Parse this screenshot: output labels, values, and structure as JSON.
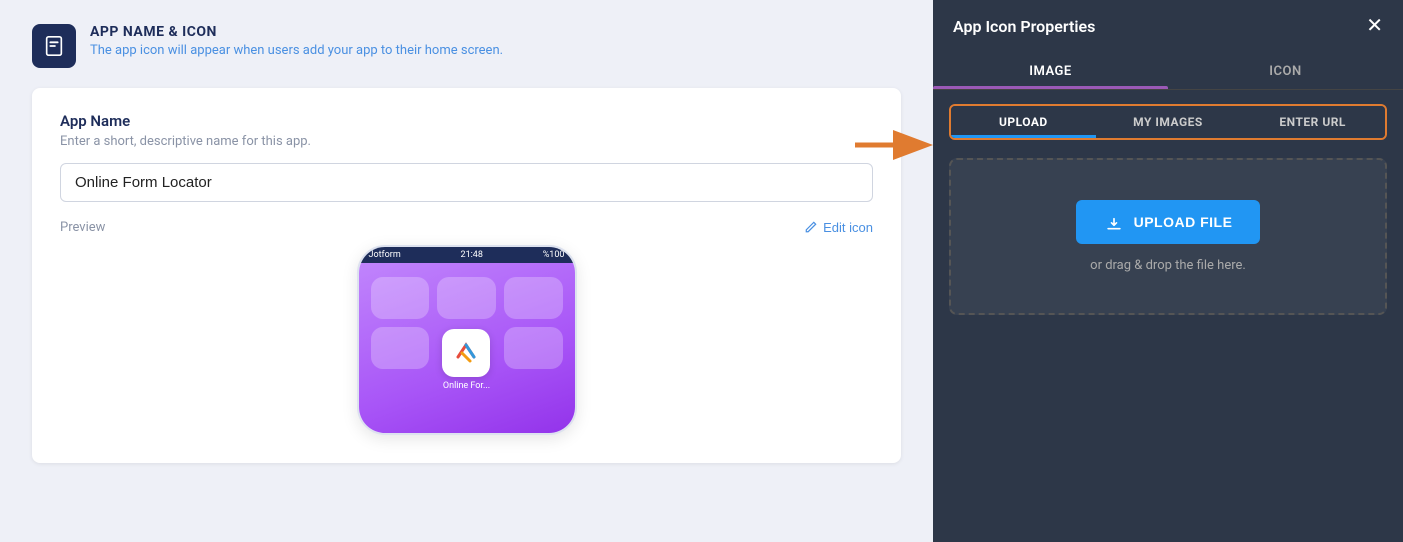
{
  "header": {
    "icon_label": "APP NAME & ICON",
    "icon_subtitle": "The app icon will appear when users add your app to their home screen."
  },
  "form": {
    "label": "App Name",
    "sublabel": "Enter a short, descriptive name for this app.",
    "value": "Online Form Locator",
    "preview_label": "Preview",
    "edit_icon_label": "Edit icon"
  },
  "phone": {
    "carrier": "Jotform",
    "time": "21:48",
    "battery": "%100",
    "app_label": "Online For..."
  },
  "right_panel": {
    "title": "App Icon Properties",
    "close_label": "✕",
    "top_tabs": [
      {
        "label": "IMAGE",
        "active": true
      },
      {
        "label": "ICON",
        "active": false
      }
    ],
    "inner_tabs": [
      {
        "label": "UPLOAD",
        "active": true
      },
      {
        "label": "MY IMAGES",
        "active": false
      },
      {
        "label": "ENTER URL",
        "active": false
      }
    ],
    "upload_btn_label": "UPLOAD FILE",
    "drag_drop_text": "or drag & drop the file here."
  }
}
